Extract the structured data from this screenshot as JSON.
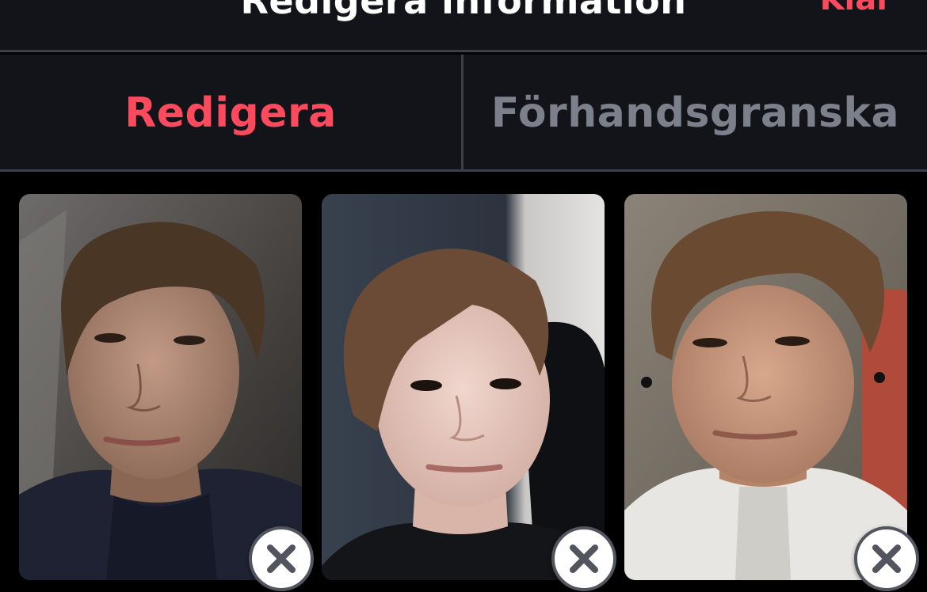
{
  "header": {
    "title": "Redigera information",
    "done_label": "Klar"
  },
  "tabs": [
    {
      "label": "Redigera",
      "active": true
    },
    {
      "label": "Förhandsgranska",
      "active": false
    }
  ],
  "photos": [
    {
      "name": "profile-photo-1",
      "remove_icon": "close-icon"
    },
    {
      "name": "profile-photo-2",
      "remove_icon": "close-icon"
    },
    {
      "name": "profile-photo-3",
      "remove_icon": "close-icon"
    }
  ],
  "colors": {
    "accent": "#fd4a5c",
    "header_bg": "#131419",
    "divider": "#3c3f47",
    "inactive_tab": "#7b808b",
    "page_bg": "#000000"
  }
}
